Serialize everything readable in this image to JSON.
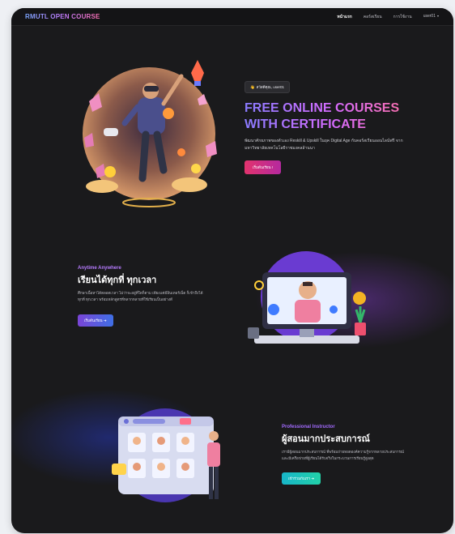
{
  "nav": {
    "brand": "RMUTL OPEN COURSE",
    "links": [
      {
        "label": "หน้าแรก",
        "active": true
      },
      {
        "label": "คอร์สเรียน",
        "active": false
      },
      {
        "label": "การใช้งาน",
        "active": false
      },
      {
        "label": "user01",
        "active": false
      }
    ],
    "user_caret": "▾"
  },
  "hero": {
    "badge_icon": "👋",
    "badge": "สวัสดีคุณ, user01",
    "title_line1": "FREE ONLINE COURSES",
    "title_line2": "WITH CERTIFICATE",
    "description": "พัฒนาศักยภาพของตัวเอง Reskill & Upskill ในยุค Digital Age กับคอร์สเรียนออนไลน์ฟรี จากมหาวิทยาลัยเทคโนโลยีราชมงคลล้านนา",
    "button": "เริ่มต้นเรียน !"
  },
  "section_anytime": {
    "eyebrow": "Anytime Anywhere",
    "title": "เรียนได้ทุกที่ ทุกเวลา",
    "description": "ศึกษาเนื้อหาได้ตลอดเวลา ไม่ว่าจะอยู่ที่ใดก็ตาม เพียงแค่มีอินเทอร์เน็ต ก็เข้าถึงได้ทุกที่ ทุกเวลา พร้อมหลักสูตรที่หลากหลายที่ใช้เรียนเป็นอย่างดี",
    "button": "เริ่มต้นเรียน ➜"
  },
  "section_instructor": {
    "eyebrow": "Professional Instructor",
    "title": "ผู้สอนมากประสบการณ์",
    "description": "เรามีผู้สอนมากประสบการณ์ ที่พร้อมถ่ายทอดองค์ความรู้จากหลายประสบการณ์ และมีเครือข่ายที่ผู้เรียนได้รับจริงในกระบวนการเรียนรู้สูงสุด",
    "button": "เข้าร่วมกับเรา ➜"
  },
  "colors": {
    "page_bg": "#1a1a1c",
    "nav_bg": "#141416",
    "hero_title_gradient": [
      "#8a7bff",
      "#d76bff",
      "#ff6f95"
    ],
    "btn_start": "#e2336d",
    "btn_blue": "#3f6fe6",
    "btn_teal": "#18b6c9"
  },
  "icons": [
    "rocket-icon",
    "gamepad-icon",
    "video-call-icon",
    "gear-icon",
    "plant-icon",
    "mug-icon",
    "search-icon"
  ]
}
